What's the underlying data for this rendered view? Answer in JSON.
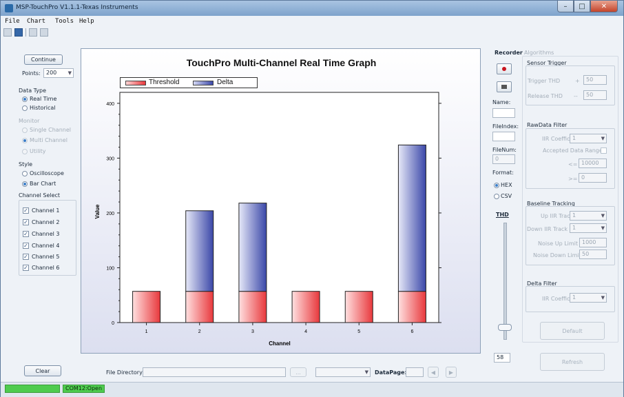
{
  "window": {
    "title": "MSP-TouchPro V1.1.1-Texas Instruments"
  },
  "menu": [
    "File",
    "Chart",
    "Tools",
    "Help"
  ],
  "left": {
    "continue_label": "Continue",
    "points_label": "Points:",
    "points_value": "200",
    "data_type_label": "Data Type",
    "real_time": "Real Time",
    "historical": "Historical",
    "monitor_label": "Monitor",
    "single_channel": "Single Channel",
    "multi_channel": "Multi Channel",
    "utility": "Utility",
    "style_label": "Style",
    "oscilloscope": "Oscilloscope",
    "bar_chart": "Bar Chart",
    "channel_select_label": "Channel Select",
    "channels": [
      "Channel 1",
      "Channel 2",
      "Channel 3",
      "Channel 4",
      "Channel 5",
      "Channel 6"
    ],
    "clear_label": "Clear"
  },
  "chart_data": {
    "type": "bar",
    "title": "TouchPro Multi-Channel Real Time Graph",
    "xlabel": "Channel",
    "ylabel": "Value",
    "categories": [
      "1",
      "2",
      "3",
      "4",
      "5",
      "6"
    ],
    "ylim": [
      0,
      420
    ],
    "yticks": [
      0,
      100,
      200,
      300,
      400
    ],
    "legend_position": "top-left",
    "series": [
      {
        "name": "Threshold",
        "values": [
          57,
          57,
          57,
          57,
          57,
          57
        ],
        "color": "#e8383c"
      },
      {
        "name": "Delta",
        "values": [
          0,
          147,
          161,
          0,
          0,
          267
        ],
        "color": "#3a47a8"
      }
    ],
    "stacked": true
  },
  "bottom": {
    "file_directory_label": "File Directory:",
    "browse_label": "...",
    "datapage_label": "DataPage:"
  },
  "recorder": {
    "label": "Recorder",
    "name_label": "Name:",
    "fileindex_label": "FileIndex:",
    "filenum_label": "FileNum:",
    "filenum_value": "0",
    "format_label": "Format:",
    "hex": "HEX",
    "csv": "CSV",
    "thd_label": "THD",
    "thd_value": "58"
  },
  "algorithms": {
    "label": "Algorithms",
    "sensor_trigger": "Sensor Trigger",
    "trigger_thd": "Trigger THD",
    "trigger_sign": "+",
    "trigger_value": "50",
    "release_thd": "Release THD",
    "release_sign": "--",
    "release_value": "50",
    "rawdata_filter": "RawData Filter",
    "iir_coefficient": "IIR Coefficient",
    "iir_value": "1",
    "accepted_range": "Accepted Data Range",
    "le_sign": "<=",
    "le_value": "10000",
    "ge_sign": ">=",
    "ge_value": "0",
    "baseline_tracking": "Baseline Tracking",
    "up_iir": "Up IIR Track",
    "up_iir_value": "1",
    "down_iir": "Down IIR Track",
    "down_iir_value": "1",
    "noise_up": "Noise Up Limit",
    "noise_up_value": "1000",
    "noise_down": "Noise Down Limit",
    "noise_down_value": "50",
    "delta_filter": "Delta Filter",
    "delta_iir": "IIR Coefficient",
    "delta_iir_value": "1",
    "default_label": "Default",
    "refresh_label": "Refresh"
  },
  "status": {
    "port": "COM12:Open",
    "progress": 1.0
  }
}
